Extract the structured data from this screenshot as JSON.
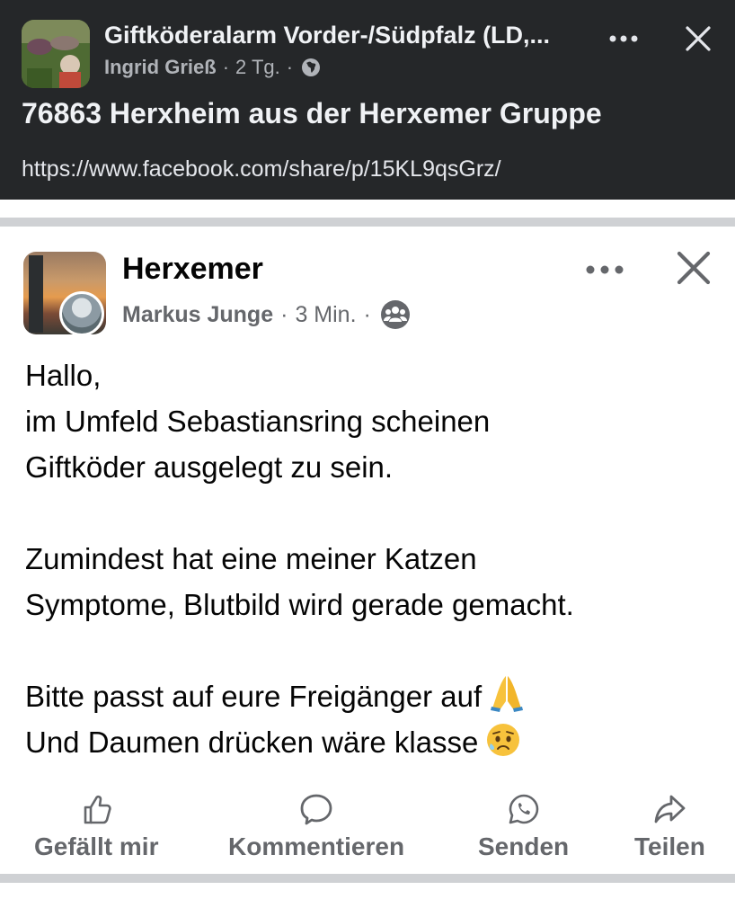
{
  "top_post": {
    "group_title": "Giftköderalarm Vorder-/Südpfalz (LD,...",
    "author": "Ingrid Grieß",
    "time": "2 Tg.",
    "separator": "·",
    "privacy_icon": "globe-icon",
    "heading": "76863 Herxheim aus der Herxemer Gruppe",
    "link": "https://www.facebook.com/share/p/15KL9qsGrz/"
  },
  "shared_post": {
    "group_name": "Herxemer",
    "author": "Markus Junge",
    "time": "3 Min.",
    "separator": "·",
    "privacy_icon": "members-icon",
    "lines": {
      "l1": "Hallo,",
      "l2": "im Umfeld Sebastiansring scheinen",
      "l3": "Giftköder ausgelegt zu sein.",
      "l4": "Zumindest hat eine meiner Katzen",
      "l5": "Symptome, Blutbild wird gerade gemacht.",
      "l6": "Bitte passt auf eure Freigänger auf",
      "l7": "Und Daumen drücken wäre klasse"
    }
  },
  "actions": {
    "like": "Gefällt mir",
    "comment": "Kommentieren",
    "send": "Senden",
    "share": "Teilen"
  },
  "colors": {
    "dark_bg": "#252729",
    "text_primary": "#050505",
    "text_secondary": "#65676b",
    "divider": "#cfd1d4"
  }
}
